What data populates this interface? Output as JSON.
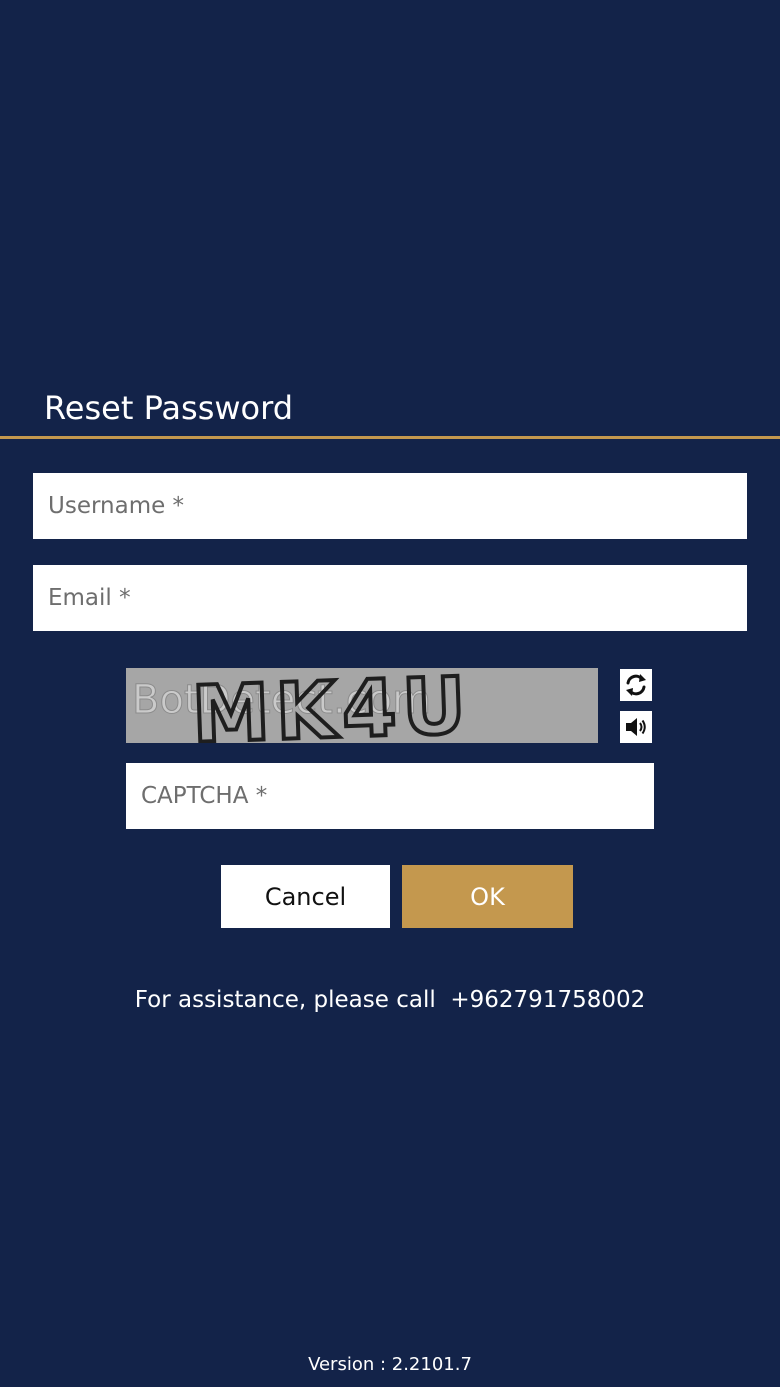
{
  "page": {
    "title": "Reset Password",
    "background_color": "#132349",
    "accent_color": "#c4984e"
  },
  "form": {
    "username_placeholder": "Username *",
    "username_value": "",
    "email_placeholder": "Email *",
    "email_value": "",
    "captcha_placeholder": "CAPTCHA *",
    "captcha_value": "",
    "captcha_image_text": "MK4U",
    "captcha_watermark_text": "BotDetect.com",
    "refresh_icon": "refresh-icon",
    "audio_icon": "speaker-icon"
  },
  "buttons": {
    "cancel_label": "Cancel",
    "ok_label": "OK"
  },
  "footer": {
    "assistance_text": "For assistance, please call",
    "phone": "+962791758002",
    "version_text": "Version : 2.2101.7"
  }
}
